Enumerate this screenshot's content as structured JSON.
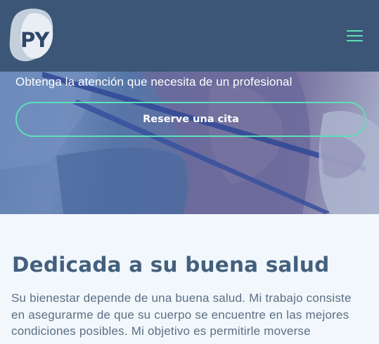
{
  "header": {
    "logo_text": "PY",
    "menu_icon": "hamburger-menu-icon"
  },
  "hero": {
    "tagline": "Obtenga la atención que necesita de un profesional",
    "cta_label": "Reserve una cita"
  },
  "main": {
    "heading": "Dedicada a su buena salud",
    "paragraph": "Su bienestar depende de una buena salud. Mi trabajo consiste en asegurarme de que su cuerpo se encuentre en las mejores condiciones posibles.  Mi objetivo es permitirle moverse"
  },
  "colors": {
    "header_bg": "#3c5677",
    "accent": "#5ee0b7",
    "heading": "#43607d",
    "body_text": "#5b6f84",
    "page_bg": "#f2f7fc"
  }
}
